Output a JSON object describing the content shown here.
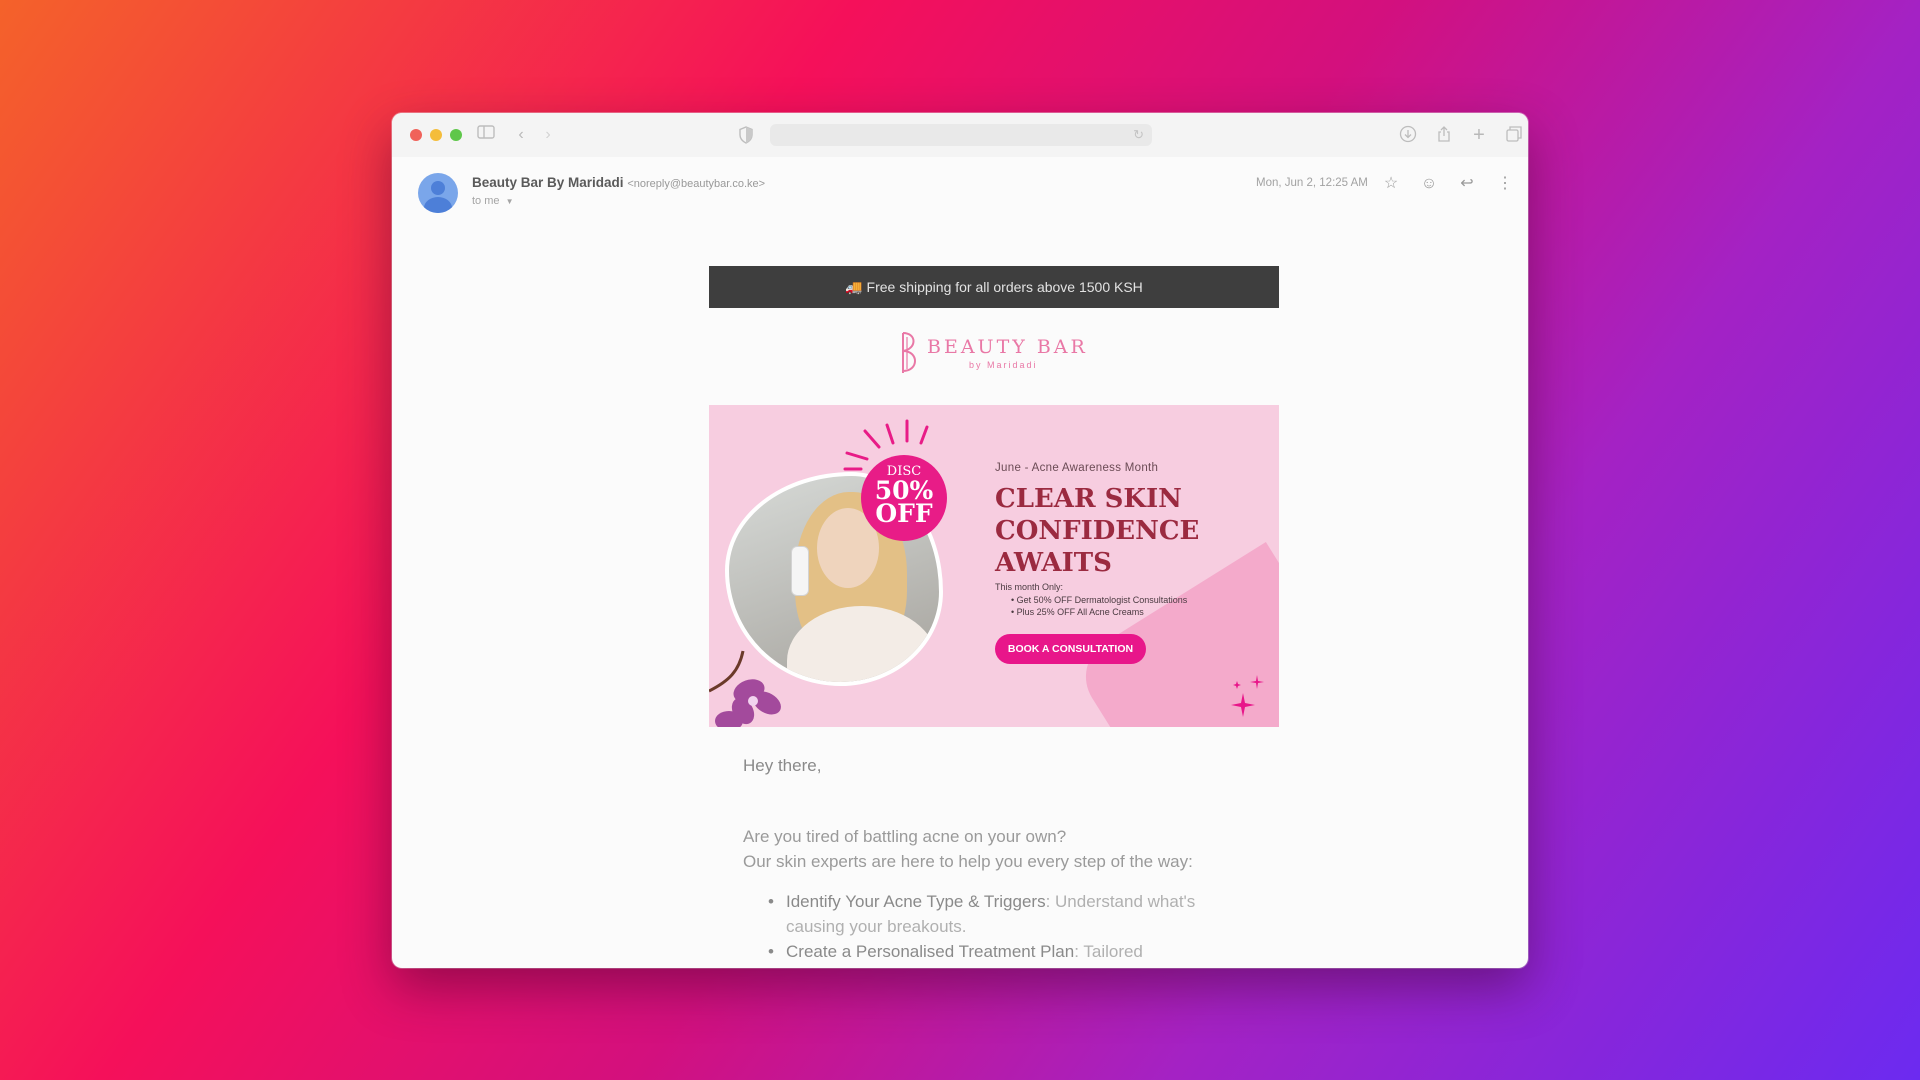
{
  "email": {
    "sender_name": "Beauty Bar By Maridadi",
    "sender_email": "<noreply@beautybar.co.ke>",
    "recipient": "to me",
    "date": "Mon, Jun 2, 12:25 AM"
  },
  "content": {
    "shipping_bar": "🚚 Free shipping for all orders above 1500 KSH",
    "logo_name": "BEAUTY BAR",
    "logo_sub": "by Maridadi",
    "banner": {
      "badge_line1": "DISC",
      "badge_line2": "50%",
      "badge_line3": "OFF",
      "kicker": "June - Acne Awareness Month",
      "title_line1": "CLEAR SKIN",
      "title_line2": "CONFIDENCE",
      "title_line3": "AWAITS",
      "subhead": "This month Only:",
      "offers": [
        "Get 50% OFF Dermatologist Consultations",
        "Plus 25% OFF All Acne Creams"
      ],
      "cta": "BOOK A CONSULTATION"
    },
    "greeting": "Hey there,",
    "para_line1": "Are you tired of battling acne on your own?",
    "para_line2": "Our skin experts are here to help you every step of the way:",
    "bullets": [
      {
        "title": "Identify Your Acne Type & Triggers",
        "text": ": Understand what's causing your breakouts."
      },
      {
        "title": "Create a Personalised Treatment Plan",
        "text": ": Tailored"
      }
    ]
  },
  "icons": {
    "toolbar": [
      "sidebar-icon",
      "back-icon",
      "forward-icon",
      "shield-icon",
      "reload-icon",
      "download-icon",
      "share-icon",
      "new-tab-icon",
      "tabs-icon"
    ],
    "header": [
      "star-icon",
      "emoji-icon",
      "reply-icon",
      "more-icon"
    ]
  },
  "colors": {
    "brand_pink": "#e8168a",
    "title_red": "#9b2a40",
    "banner_bg": "#f7cde0"
  }
}
